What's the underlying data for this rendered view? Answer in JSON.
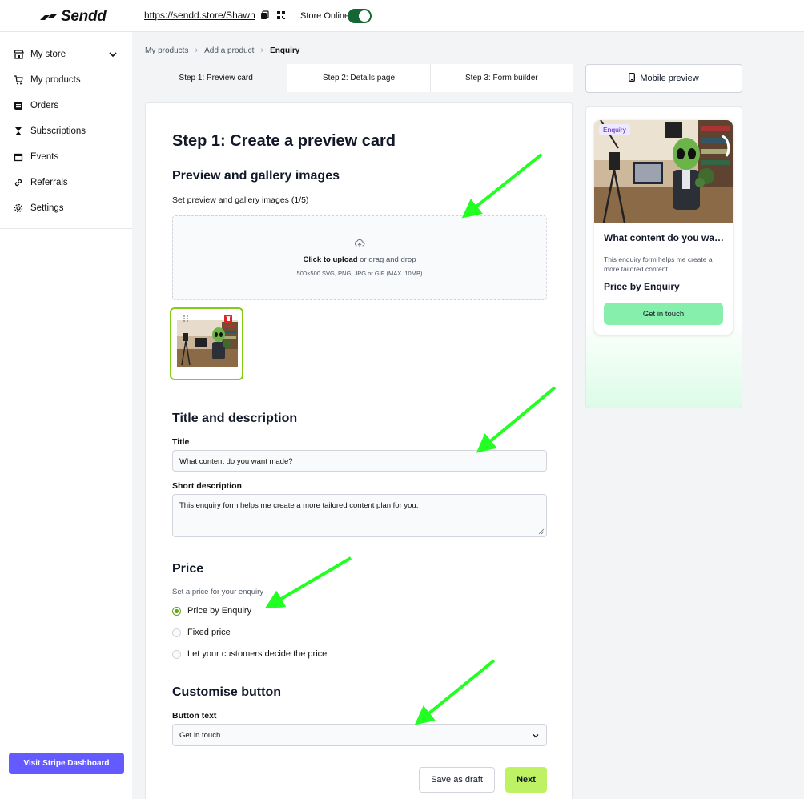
{
  "app": {
    "logo_text": "Sendd"
  },
  "topbar": {
    "store_url": "https://sendd.store/Shawn",
    "store_online_label": "Store Online",
    "store_online": true
  },
  "sidebar": {
    "items": [
      {
        "label": "My store",
        "icon": "store-icon",
        "expandable": true
      },
      {
        "label": "My products",
        "icon": "cart-icon"
      },
      {
        "label": "Orders",
        "icon": "inbox-icon"
      },
      {
        "label": "Subscriptions",
        "icon": "hourglass-icon"
      },
      {
        "label": "Events",
        "icon": "calendar-icon"
      },
      {
        "label": "Referrals",
        "icon": "link-icon"
      },
      {
        "label": "Settings",
        "icon": "gear-icon"
      }
    ],
    "stripe_button": "Visit Stripe Dashboard",
    "stripe_color": "#635bff"
  },
  "breadcrumb": {
    "items": [
      "My products",
      "Add a product"
    ],
    "current": "Enquiry"
  },
  "steps": [
    {
      "label": "Step 1: Preview card",
      "active": true
    },
    {
      "label": "Step 2: Details page",
      "active": false
    },
    {
      "label": "Step 3: Form builder",
      "active": false
    }
  ],
  "form": {
    "heading": "Step 1: Create a preview card",
    "images_section": {
      "title": "Preview and gallery images",
      "label": "Set preview and gallery images (1/5)",
      "upload_click": "Click to upload",
      "upload_rest": " or drag and drop",
      "upload_hint": "500×500 SVG, PNG, JPG or GIF (MAX. 10MB)"
    },
    "title_section": {
      "title": "Title and description",
      "title_label": "Title",
      "title_value": "What content do you want made?",
      "desc_label": "Short description",
      "desc_value": "This enquiry form helps me create a more tailored content plan for you."
    },
    "price_section": {
      "title": "Price",
      "sublabel": "Set a price for your enquiry",
      "options": [
        "Price by Enquiry",
        "Fixed price",
        "Let your customers decide the price"
      ],
      "selected_index": 0
    },
    "button_section": {
      "title": "Customise button",
      "label": "Button text",
      "value": "Get in touch"
    },
    "save_draft": "Save as draft",
    "next": "Next"
  },
  "preview": {
    "mobile_button": "Mobile preview",
    "badge": "Enquiry",
    "title": "What content do you want made?",
    "desc": "This enquiry form helps me create a more tailored content…",
    "price": "Price by Enquiry",
    "cta": "Get in touch"
  },
  "colors": {
    "accent_green": "#bef264",
    "toggle_green": "#166534",
    "arrow_green": "#22ff22"
  }
}
